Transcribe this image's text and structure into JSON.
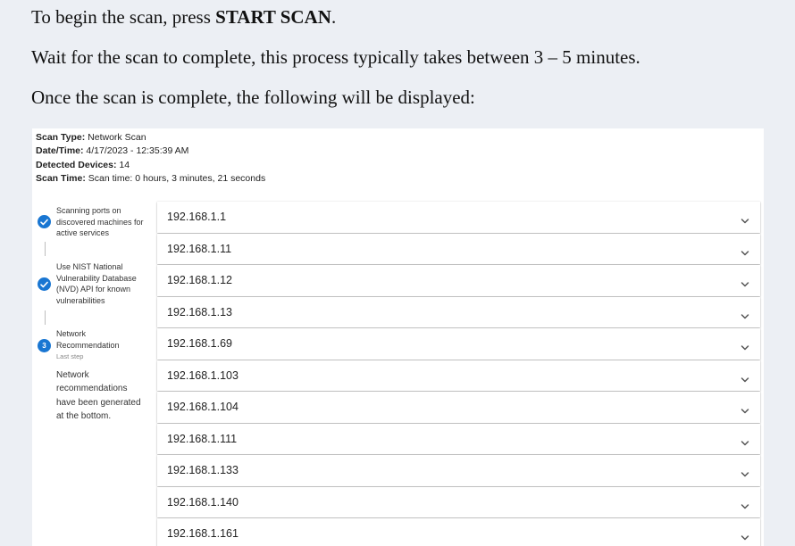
{
  "instructions": {
    "line1_prefix": "To begin the scan, press ",
    "line1_bold": "START SCAN",
    "line1_suffix": ".",
    "line2": "Wait for the scan to complete, this process typically takes between 3 – 5 minutes.",
    "line3": "Once the scan is complete, the following will be displayed:"
  },
  "scan_info": {
    "type_label": "Scan Type:",
    "type_value": "Network Scan",
    "datetime_label": "Date/Time:",
    "datetime_value": "4/17/2023 - 12:35:39 AM",
    "devices_label": "Detected Devices:",
    "devices_value": "14",
    "time_label": "Scan Time:",
    "time_value": "Scan time: 0 hours, 3 minutes, 21 seconds"
  },
  "steps": [
    {
      "label_lines": [
        "Scanning ports on",
        "discovered machines for",
        "active services"
      ],
      "status": "completed"
    },
    {
      "label_lines": [
        "Use NIST National",
        "Vulnerability Database",
        "(NVD) API for known",
        "vulnerabilities"
      ],
      "status": "completed"
    },
    {
      "label_lines": [
        "Network",
        "Recommendation"
      ],
      "number": "3",
      "optional": "Last step",
      "status": "active",
      "content_lines": [
        "Network",
        "recommendations",
        "have been generated",
        "at the bottom."
      ]
    }
  ],
  "devices": [
    "192.168.1.1",
    "192.168.1.11",
    "192.168.1.12",
    "192.168.1.13",
    "192.168.1.69",
    "192.168.1.103",
    "192.168.1.104",
    "192.168.1.111",
    "192.168.1.133",
    "192.168.1.140",
    "192.168.1.161"
  ],
  "colors": {
    "accent": "#1976d2",
    "background": "#eceff4"
  },
  "icons": {
    "completed": "check-circle-icon",
    "expand": "chevron-down-icon"
  }
}
